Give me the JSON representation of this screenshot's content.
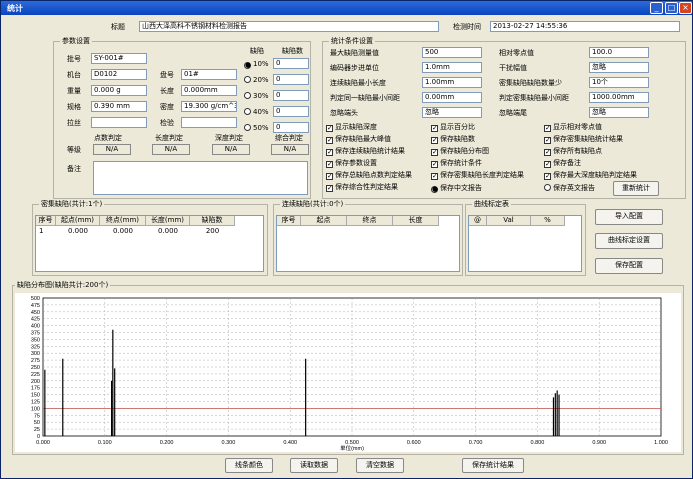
{
  "window": {
    "title": "统计",
    "minimize": "_",
    "maximize": "□",
    "close": "×"
  },
  "header": {
    "title_label": "标题",
    "title_value": "山西大泽高科不锈钢材料检测报告",
    "time_label": "检测时间",
    "time_value": "2013-02-27 14:55:36"
  },
  "params": {
    "group_title": "参数设置",
    "batch_label": "批号",
    "batch_value": "SY-001#",
    "machine_label": "机台",
    "machine_value": "D0102",
    "reel_label": "盘号",
    "reel_value": "01#",
    "weight_label": "重量",
    "weight_value": "0.000 g",
    "length_label": "长度",
    "length_value": "0.000mm",
    "spec_label": "规格",
    "spec_value": "0.390 mm",
    "density_label": "密度",
    "density_value": "19.300 g/cm^3",
    "drawn_label": "拉丝",
    "check_label": "检验",
    "defect_label": "缺陷",
    "defect_count_label": "缺陷数",
    "radios": [
      {
        "label": "10%",
        "value": "0",
        "checked": true
      },
      {
        "label": "20%",
        "value": "0",
        "checked": false
      },
      {
        "label": "30%",
        "value": "0",
        "checked": false
      },
      {
        "label": "40%",
        "value": "0",
        "checked": false
      },
      {
        "label": "50%",
        "value": "0",
        "checked": false
      }
    ],
    "judge_headers": [
      "点数判定",
      "长度判定",
      "深度判定",
      "综合判定"
    ],
    "grade_label": "等级",
    "grade_values": [
      "N/A",
      "N/A",
      "N/A",
      "N/A"
    ],
    "note_label": "备注"
  },
  "stats": {
    "group_title": "统计条件设置",
    "max_depth_label": "最大缺陷测量值",
    "max_depth_value": "500",
    "rel_zero_label": "相对零点值",
    "rel_zero_value": "100.0",
    "encoder_label": "编码器步进单位",
    "encoder_value": "1.0mm",
    "interference_label": "干扰幅值",
    "interference_value": "忽略",
    "cont_min_len_label": "连续缺陷最小长度",
    "cont_min_len_value": "1.00mm",
    "dense_min_label": "密集缺陷缺陷数量少",
    "dense_min_value": "10个",
    "same_gap_label": "判定同一缺陷最小间距",
    "same_gap_value": "0.00mm",
    "dense_gap_label": "判定密集缺陷最小间距",
    "dense_gap_value": "1000.00mm",
    "ignore_head_label": "忽略端头",
    "ignore_head_value": "忽略",
    "ignore_tail_label": "忽略端尾",
    "ignore_tail_value": "忽略",
    "checks": [
      "显示缺陷深度",
      "显示百分比",
      "显示相对零点值",
      "保存缺陷最大峰值",
      "保存缺陷数",
      "保存密集缺陷统计结果",
      "保存连续缺陷统计结果",
      "保存缺陷分布图",
      "保存所有缺陷点",
      "保存参数设置",
      "保存统计条件",
      "保存备注",
      "保存总缺陷点数判定结果",
      "保存密集缺陷长度判定结果",
      "保存最大深度缺陷判定结果",
      "保存综合性判定结果"
    ],
    "radio_cn": "保存中文报告",
    "radio_en": "保存英文报告",
    "recount_button": "重新统计"
  },
  "dense_table": {
    "title": "密集缺陷(共计:1个)",
    "headers": [
      "序号",
      "起点(mm)",
      "终点(mm)",
      "长度(mm)",
      "缺陷数"
    ],
    "rows": [
      [
        "1",
        "0.000",
        "0.000",
        "0.000",
        "200"
      ]
    ]
  },
  "cont_table": {
    "title": "连续缺陷(共计:0个)",
    "headers": [
      "序号",
      "起点",
      "终点",
      "长度"
    ]
  },
  "calib_table": {
    "title": "曲线标定表",
    "headers": [
      "@",
      "Val",
      "%"
    ]
  },
  "side_buttons": {
    "import": "导入配置",
    "calib": "曲线标定设置",
    "save": "保存配置"
  },
  "chart_section_title": "缺陷分布图(缺陷共计:200个)",
  "chart_data": {
    "type": "bar",
    "xlabel": "单位(mm)",
    "xlim": [
      0,
      1
    ],
    "ylim": [
      0,
      500
    ],
    "x_ticks": [
      "0.000",
      "0.100",
      "0.200",
      "0.300",
      "0.400",
      "0.500",
      "0.600",
      "0.700",
      "0.800",
      "0.900",
      "1.000"
    ],
    "y_ticks": [
      "500",
      "475",
      "450",
      "425",
      "400",
      "375",
      "350",
      "325",
      "300",
      "275",
      "250",
      "225",
      "200",
      "175",
      "150",
      "125",
      "100",
      "75",
      "50",
      "25",
      "0"
    ],
    "reference_line": 100,
    "reference_color": "#c0504d",
    "bar_color": "#000000",
    "points": [
      {
        "x": 0.003,
        "y": 240
      },
      {
        "x": 0.032,
        "y": 280
      },
      {
        "x": 0.111,
        "y": 200
      },
      {
        "x": 0.113,
        "y": 385
      },
      {
        "x": 0.116,
        "y": 245
      },
      {
        "x": 0.425,
        "y": 280
      },
      {
        "x": 0.826,
        "y": 140
      },
      {
        "x": 0.829,
        "y": 155
      },
      {
        "x": 0.832,
        "y": 165
      },
      {
        "x": 0.835,
        "y": 150
      }
    ]
  },
  "bottom_buttons": {
    "color": "线条颜色",
    "read": "读取数据",
    "clear": "清空数据",
    "save": "保存统计结果"
  }
}
